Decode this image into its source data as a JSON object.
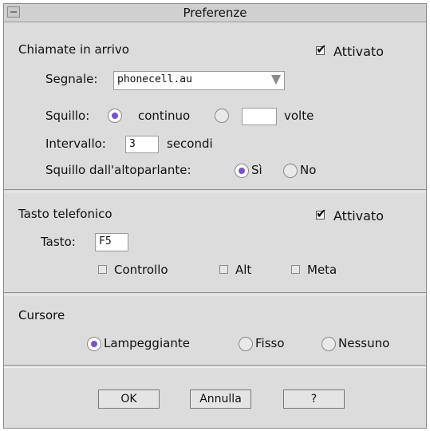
{
  "window": {
    "title": "Preferenze"
  },
  "incoming": {
    "heading": "Chiamate in arrivo",
    "enabled_label": "Attivato",
    "signal_label": "Segnale:",
    "signal_value": "phonecell.au",
    "ring_label": "Squillo:",
    "ring_continuous": "continuo",
    "ring_times_value": "",
    "ring_times_label": "volte",
    "interval_label": "Intervallo:",
    "interval_value": "3",
    "interval_unit": "secondi",
    "speaker_label": "Squillo dall'altoparlante:",
    "speaker_yes": "Sì",
    "speaker_no": "No"
  },
  "hotkey": {
    "heading": "Tasto telefonico",
    "enabled_label": "Attivato",
    "key_label": "Tasto:",
    "key_value": "F5",
    "modifiers": [
      "Controllo",
      "Alt",
      "Meta"
    ]
  },
  "cursor": {
    "heading": "Cursore",
    "options": [
      "Lampeggiante",
      "Fisso",
      "Nessuno"
    ]
  },
  "buttons": {
    "ok": "OK",
    "cancel": "Annulla",
    "help": "?"
  }
}
